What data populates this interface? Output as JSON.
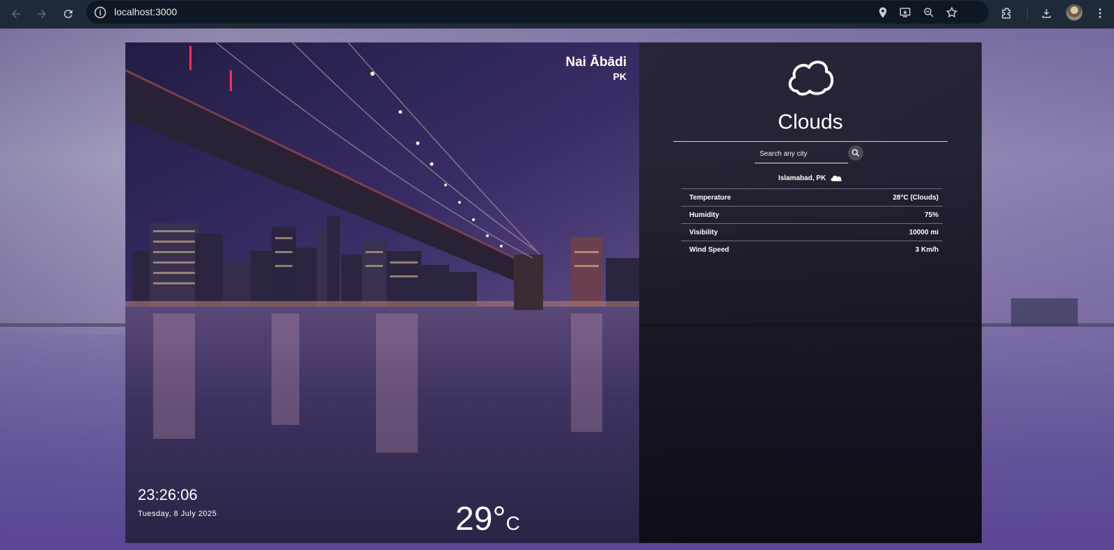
{
  "browser": {
    "url": "localhost:3000",
    "icons": [
      "back-icon",
      "forward-icon",
      "reload-icon",
      "info-icon",
      "location-icon",
      "install-icon",
      "zoom-icon",
      "star-icon",
      "extensions-icon",
      "download-icon",
      "more-icon"
    ]
  },
  "hero": {
    "city_name": "Nai Ābādi",
    "country": "PK",
    "time": "23:26:06",
    "date": "Tuesday, 8 July 2025",
    "temperature": "29°",
    "unit": "C"
  },
  "details": {
    "condition": "Clouds",
    "search_placeholder": "Search any city",
    "location": "Islamabad, PK",
    "stats": [
      {
        "label": "Temperature",
        "value": "28°C (Clouds)"
      },
      {
        "label": "Humidity",
        "value": "75%"
      },
      {
        "label": "Visibility",
        "value": "10000 mi"
      },
      {
        "label": "Wind Speed",
        "value": "3 Km/h"
      }
    ]
  }
}
